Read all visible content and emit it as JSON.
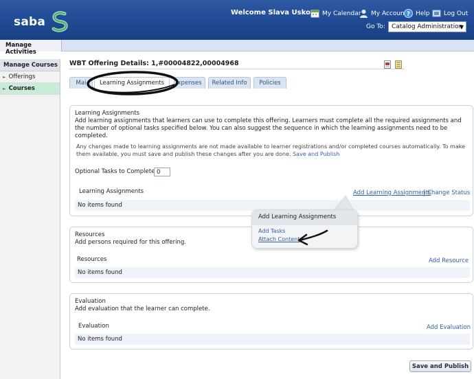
{
  "header": {
    "brand": "saba",
    "welcome": "Welcome Slava Uskov",
    "links": {
      "calendar": "My Calendar",
      "account": "My Account",
      "help": "Help",
      "logout": "Log Out"
    },
    "goto_label": "Go To:",
    "goto_value": "Catalog Administration"
  },
  "subbar": {
    "manage_activities": "Manage Activities"
  },
  "sidebar": {
    "heading": "Manage Courses",
    "items": [
      {
        "label": "Offerings"
      },
      {
        "label": "Courses"
      }
    ]
  },
  "main": {
    "title": "WBT Offering Details: 1,#00004822,00004968",
    "tabs": [
      "Main",
      "Learning Assignments",
      "Expenses",
      "Related Info",
      "Policies"
    ],
    "tab_visible": {
      "main": "Mai",
      "expenses": "xpenses"
    },
    "learning": {
      "title": "Learning Assignments",
      "description": "Add learning assignments that learners can use to complete this offering. Learners must complete all the required assignments and the number of optional tasks specified below. You can also suggest the sequence in which the learning assignments need to be completed.",
      "note": "Any changes made to learning assignments are not made available to learner registrations and/or completed courses automatically. To make them available, you must save and publish these changes after you are done.",
      "note_link": "Save and Publish",
      "optional_label": "Optional Tasks to Complete",
      "optional_value": "0",
      "list_label": "Learning Assignments",
      "add_link": "Add Learning Assignments",
      "change_link": "Change Status",
      "empty": "No items found"
    },
    "resources": {
      "title": "Resources",
      "description": "Add persons required for this offering.",
      "list_label": "Resources",
      "add_link": "Add Resource",
      "empty": "No items found"
    },
    "evaluation": {
      "title": "Evaluation",
      "description": "Add evaluation that the learner can complete.",
      "list_label": "Evaluation",
      "add_link": "Add Evaluation",
      "empty": "No items found"
    },
    "callout": {
      "title": "Add Learning Assignments",
      "items": [
        "Add Tasks",
        "Attach Content"
      ]
    },
    "save_button": "Save and Publish"
  },
  "colors": {
    "header_blue": "#1f4a93",
    "link_blue": "#2e5ea9",
    "sidebar_active": "#c8ecd8"
  }
}
